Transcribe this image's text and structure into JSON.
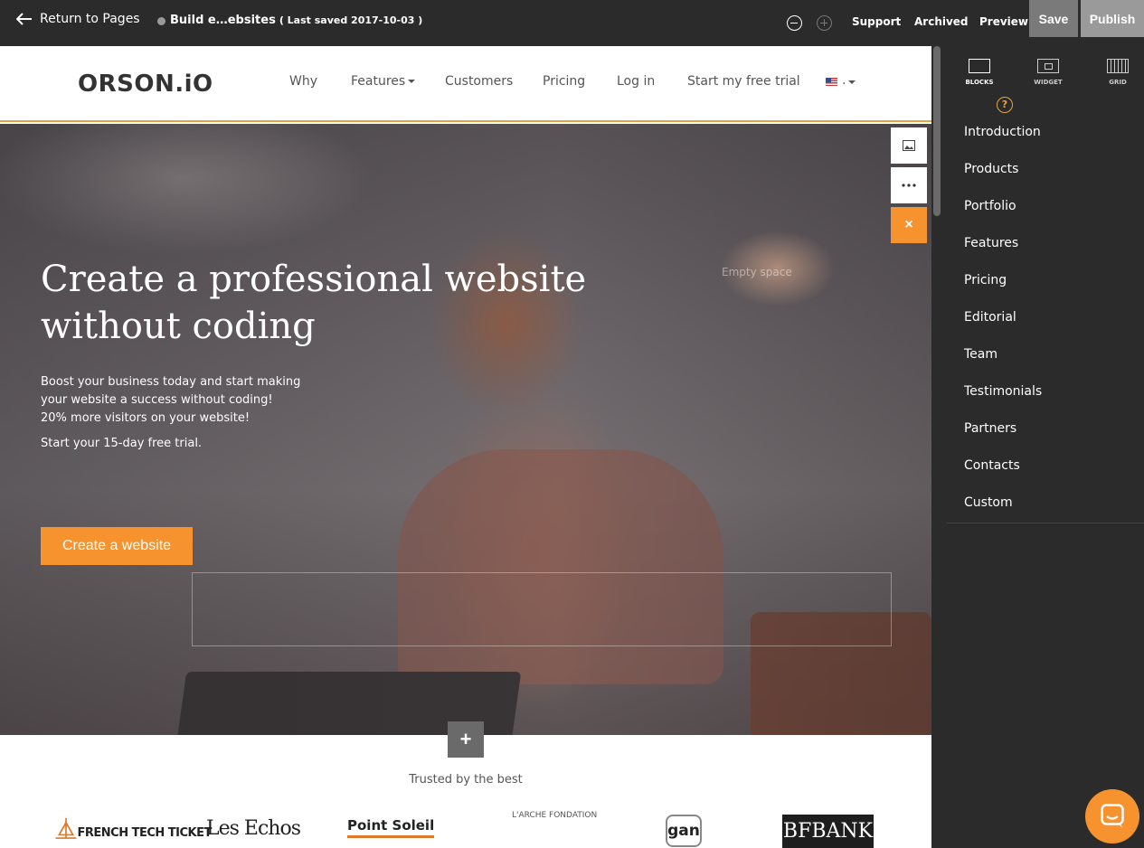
{
  "topbar": {
    "back_label": "Return to Pages",
    "doc_title": "Build e…ebsites",
    "last_saved": "( Last saved 2017-10-03 )",
    "links": [
      "Support",
      "Archived",
      "Preview"
    ],
    "save_label": "Save",
    "publish_label": "Publish"
  },
  "site": {
    "logo": "ORSON.iO",
    "nav": [
      "Why",
      "Features",
      "Customers",
      "Pricing",
      "Log in",
      "Start my free trial"
    ],
    "lang_dot": "."
  },
  "hero": {
    "title": "Create a professional website without coding",
    "lead": [
      "Boost your business today and start making",
      "your website a success without coding!",
      "20% more visitors on your website!"
    ],
    "trial": "Start your 15-day free trial.",
    "cta": "Create a website",
    "empty_space": "Empty space",
    "close_glyph": "×",
    "add_glyph": "+"
  },
  "trusted": {
    "heading": "Trusted by the best",
    "logos": [
      "FRENCH TECH TICKET",
      "Les Echos",
      "Point Soleil",
      "L'ARCHE FONDATION",
      "gan",
      "BFBANK"
    ]
  },
  "panel": {
    "tabs": [
      "BLOCKS",
      "WIDGET",
      "GRID"
    ],
    "help_glyph": "?",
    "blocks": [
      "Introduction",
      "Products",
      "Portfolio",
      "Features",
      "Pricing",
      "Editorial",
      "Team",
      "Testimonials",
      "Partners",
      "Contacts",
      "Custom"
    ]
  },
  "colors": {
    "accent": "#f7932f",
    "topbar_bg": "#2b2b2b",
    "nav_underline": "#e8a341"
  },
  "icons": [
    "arrow-left-icon",
    "zoom-out-icon",
    "zoom-in-icon",
    "image-icon",
    "more-icon",
    "close-icon",
    "plus-icon",
    "blocks-icon",
    "widget-icon",
    "grid-icon",
    "help-icon",
    "chat-icon",
    "us-flag-icon"
  ]
}
